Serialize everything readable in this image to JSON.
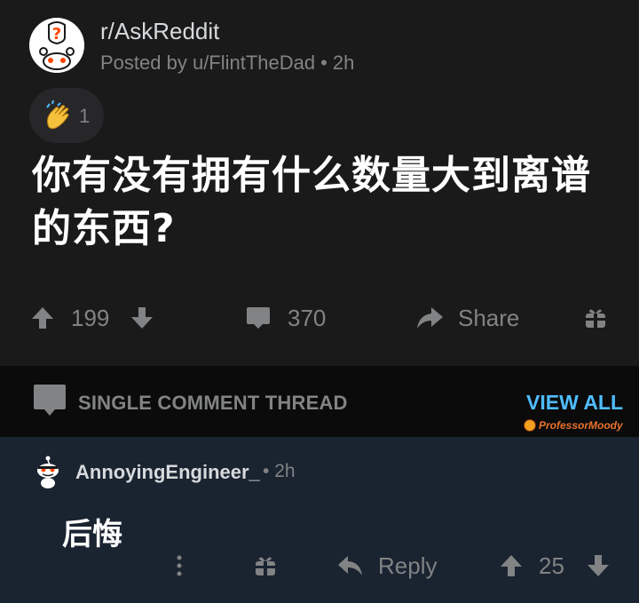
{
  "post": {
    "subreddit": "r/AskReddit",
    "posted_by": "Posted by u/FlintTheDad",
    "time": "2h",
    "award_count": "1",
    "title": "你有没有拥有什么数量大到离谱的东西?"
  },
  "actions": {
    "upvotes": "199",
    "comments": "370",
    "share": "Share"
  },
  "thread": {
    "label": "SINGLE COMMENT THREAD",
    "view_all": "VIEW ALL",
    "watermark": "ProfessorMoody"
  },
  "comment": {
    "author": "AnnoyingEngineer_",
    "time": "2h",
    "body": "后悔",
    "reply": "Reply",
    "score": "25"
  },
  "colors": {
    "background": "#1a1a1b",
    "comment_bg": "#1a2330",
    "divider_bg": "#0b0b0b",
    "muted": "#818384",
    "link": "#4fbcff"
  }
}
